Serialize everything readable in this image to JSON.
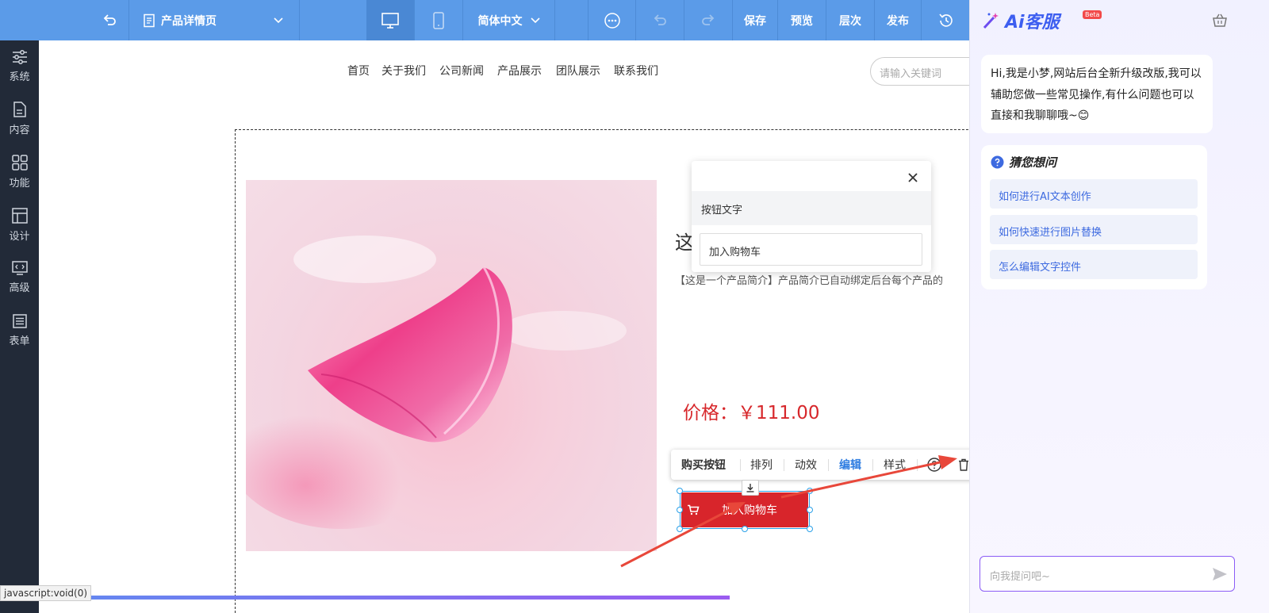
{
  "toolbar": {
    "page_name": "产品详情页",
    "language": "简体中文",
    "save": "保存",
    "preview": "预览",
    "layers": "层次",
    "publish": "发布"
  },
  "sidebar": {
    "items": [
      {
        "label": "系统",
        "icon": "sliders-icon"
      },
      {
        "label": "内容",
        "icon": "document-icon"
      },
      {
        "label": "功能",
        "icon": "grid-icon"
      },
      {
        "label": "设计",
        "icon": "layout-icon"
      },
      {
        "label": "高级",
        "icon": "code-icon"
      },
      {
        "label": "表单",
        "icon": "form-icon"
      }
    ]
  },
  "site": {
    "nav": [
      "首页",
      "关于我们",
      "公司新闻",
      "产品展示",
      "团队展示",
      "联系我们"
    ],
    "search_placeholder": "请输入关键词",
    "product_title_fragment": "这是",
    "product_desc_fragment": "【这是一个产品简介】产品简介已自动绑定后台每个产品的",
    "price": "价格：￥111.00",
    "cart_button": "加入购物车"
  },
  "edit_toolbar": {
    "items": [
      "购买按钮",
      "排列",
      "动效",
      "编辑",
      "样式"
    ],
    "active": "编辑"
  },
  "popup": {
    "label": "按钮文字",
    "value": "加入购物车"
  },
  "status_bar": "javascript:void(0)",
  "ai_panel": {
    "title": "Ai客服",
    "beta": "Beta",
    "greeting": "Hi,我是小梦,网站后台全新升级改版,我可以辅助您做一些常见操作,有什么问题也可以直接和我聊聊哦~😊",
    "faq_title": "猜您想问",
    "faq": [
      "如何进行AI文本创作",
      "如何快速进行图片替换",
      "怎么编辑文字控件"
    ],
    "input_placeholder": "向我提问吧~"
  },
  "colors": {
    "toolbar": "#5b9be8",
    "sidebar": "#222a38",
    "price": "#d7272b",
    "cart_button": "#d8252b",
    "ai_accent": "#3d5ef0",
    "arrow": "#e8473a"
  }
}
